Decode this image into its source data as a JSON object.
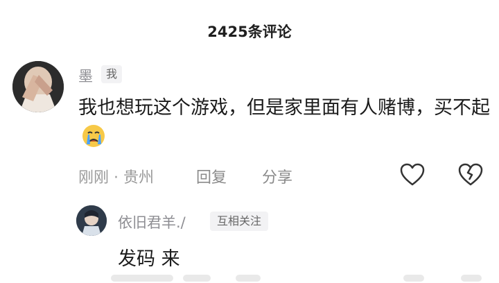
{
  "header": {
    "title": "2425条评论"
  },
  "comments": [
    {
      "username": "墨",
      "badge": "我",
      "text": "我也想玩这个游戏，但是家里面有人赌博，买不起",
      "emoji": "crying-face-emoji",
      "time": "刚刚 · 贵州",
      "reply_label": "回复",
      "share_label": "分享",
      "icons": [
        "heart-outline-icon",
        "broken-heart-icon"
      ]
    }
  ],
  "replies": [
    {
      "username": "依旧君羊./",
      "badge": "互相关注",
      "text": "发码 来"
    }
  ],
  "colors": {
    "text_primary": "#1b1b1b",
    "text_secondary": "#9a9a9a",
    "badge_bg": "#f2f2f4"
  }
}
